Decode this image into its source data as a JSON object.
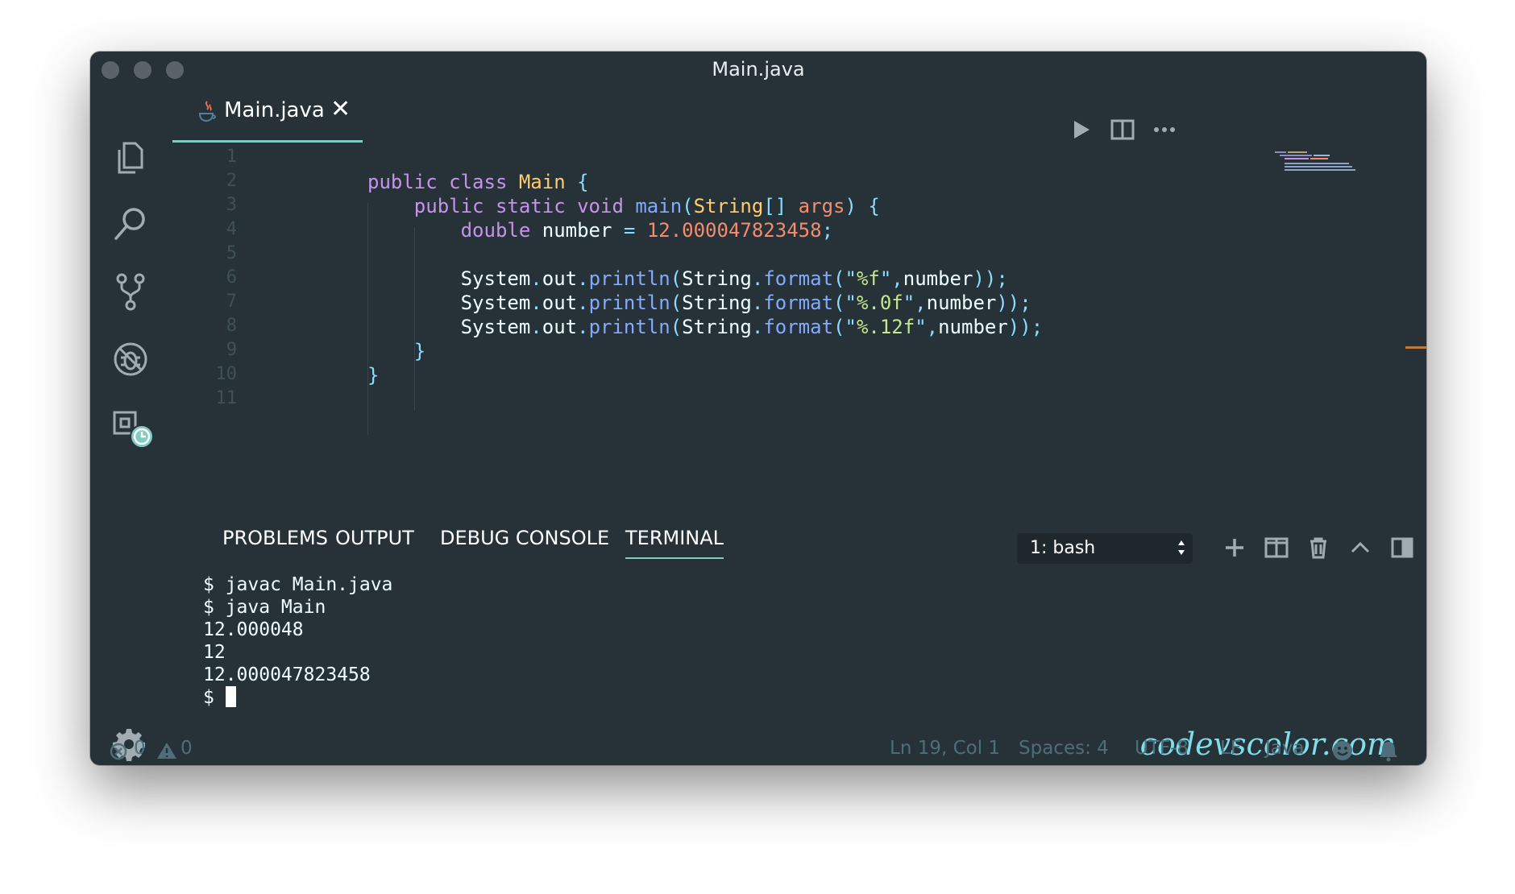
{
  "window": {
    "title": "Main.java"
  },
  "activity_bar": {
    "items": [
      {
        "name": "explorer",
        "icon": "files-icon"
      },
      {
        "name": "search",
        "icon": "search-icon"
      },
      {
        "name": "source-control",
        "icon": "git-branch-icon"
      },
      {
        "name": "debug",
        "icon": "no-bug-icon"
      },
      {
        "name": "extensions",
        "icon": "extensions-clock-icon"
      }
    ],
    "settings_icon": "gear-icon"
  },
  "tab": {
    "label": "Main.java",
    "close": "✕",
    "icon": "java-icon"
  },
  "editor": {
    "line_numbers": [
      "1",
      "2",
      "3",
      "4",
      "5",
      "6",
      "7",
      "8",
      "9",
      "10",
      "11"
    ],
    "lines": [
      [],
      [
        {
          "t": "public ",
          "c": "kw"
        },
        {
          "t": "class ",
          "c": "kw"
        },
        {
          "t": "Main ",
          "c": "cls"
        },
        {
          "t": "{",
          "c": "pun"
        }
      ],
      [
        {
          "t": "    public ",
          "c": "kw"
        },
        {
          "t": "static ",
          "c": "kw"
        },
        {
          "t": "void ",
          "c": "kw"
        },
        {
          "t": "main",
          "c": "fn"
        },
        {
          "t": "(",
          "c": "pun"
        },
        {
          "t": "String",
          "c": "cls"
        },
        {
          "t": "[] ",
          "c": "pun"
        },
        {
          "t": "args",
          "c": "prm"
        },
        {
          "t": ") {",
          "c": "pun"
        }
      ],
      [
        {
          "t": "        double ",
          "c": "kw"
        },
        {
          "t": "number ",
          "c": "var"
        },
        {
          "t": "= ",
          "c": "pun"
        },
        {
          "t": "12.000047823458",
          "c": "num"
        },
        {
          "t": ";",
          "c": "pun"
        }
      ],
      [],
      [
        {
          "t": "        System",
          "c": "var"
        },
        {
          "t": ".",
          "c": "pun"
        },
        {
          "t": "out",
          "c": "var"
        },
        {
          "t": ".",
          "c": "pun"
        },
        {
          "t": "println",
          "c": "fn"
        },
        {
          "t": "(",
          "c": "pun"
        },
        {
          "t": "String",
          "c": "var"
        },
        {
          "t": ".",
          "c": "pun"
        },
        {
          "t": "format",
          "c": "fn"
        },
        {
          "t": "(\"",
          "c": "pun"
        },
        {
          "t": "%f",
          "c": "str"
        },
        {
          "t": "\",",
          "c": "pun"
        },
        {
          "t": "number",
          "c": "var"
        },
        {
          "t": "));",
          "c": "pun"
        }
      ],
      [
        {
          "t": "        System",
          "c": "var"
        },
        {
          "t": ".",
          "c": "pun"
        },
        {
          "t": "out",
          "c": "var"
        },
        {
          "t": ".",
          "c": "pun"
        },
        {
          "t": "println",
          "c": "fn"
        },
        {
          "t": "(",
          "c": "pun"
        },
        {
          "t": "String",
          "c": "var"
        },
        {
          "t": ".",
          "c": "pun"
        },
        {
          "t": "format",
          "c": "fn"
        },
        {
          "t": "(\"",
          "c": "pun"
        },
        {
          "t": "%.0f",
          "c": "str"
        },
        {
          "t": "\",",
          "c": "pun"
        },
        {
          "t": "number",
          "c": "var"
        },
        {
          "t": "));",
          "c": "pun"
        }
      ],
      [
        {
          "t": "        System",
          "c": "var"
        },
        {
          "t": ".",
          "c": "pun"
        },
        {
          "t": "out",
          "c": "var"
        },
        {
          "t": ".",
          "c": "pun"
        },
        {
          "t": "println",
          "c": "fn"
        },
        {
          "t": "(",
          "c": "pun"
        },
        {
          "t": "String",
          "c": "var"
        },
        {
          "t": ".",
          "c": "pun"
        },
        {
          "t": "format",
          "c": "fn"
        },
        {
          "t": "(\"",
          "c": "pun"
        },
        {
          "t": "%.12f",
          "c": "str"
        },
        {
          "t": "\",",
          "c": "pun"
        },
        {
          "t": "number",
          "c": "var"
        },
        {
          "t": "));",
          "c": "pun"
        }
      ],
      [
        {
          "t": "    }",
          "c": "pun"
        }
      ],
      [
        {
          "t": "}",
          "c": "pun"
        }
      ],
      []
    ]
  },
  "panel": {
    "tabs": [
      "PROBLEMS",
      "OUTPUT",
      "DEBUG CONSOLE",
      "TERMINAL"
    ],
    "active_tab": "TERMINAL",
    "terminal_select": "1: bash"
  },
  "terminal": {
    "lines": [
      "$ javac Main.java",
      "$ java Main",
      "12.000048",
      "12",
      "12.000047823458"
    ],
    "prompt": "$ "
  },
  "watermark": "codevscolor.com",
  "statusbar": {
    "errors": "0",
    "warnings": "0",
    "position": "Ln 19, Col 1",
    "spaces": "Spaces: 4",
    "encoding": "UTF-8",
    "eol": "LF",
    "language": "Java"
  },
  "colors": {
    "background": "#263238",
    "accent": "#80cbc4",
    "keyword": "#c792ea",
    "class": "#ffcb6b",
    "function": "#82aaff",
    "number": "#f78c6c",
    "string": "#c3e88d",
    "punctuation": "#89ddff"
  }
}
